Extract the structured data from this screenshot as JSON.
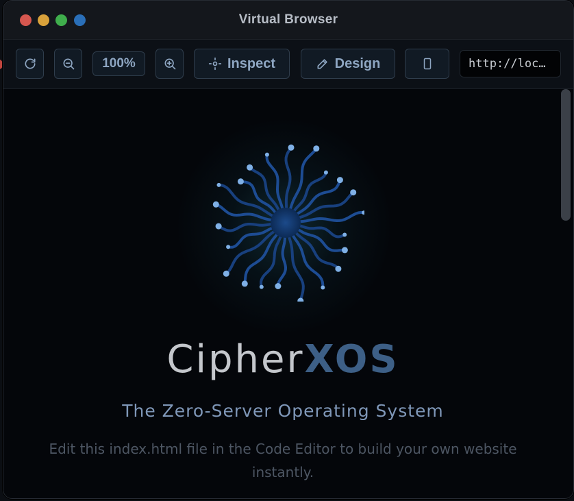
{
  "window": {
    "title": "Virtual Browser"
  },
  "toolbar": {
    "zoom_level": "100%",
    "inspect_label": "Inspect",
    "design_label": "Design",
    "url": "http://localhost"
  },
  "page": {
    "brand_part1": "Cipher",
    "brand_part2": "XOS",
    "tagline": "The Zero-Server Operating System",
    "description": "Edit this index.html file in the Code Editor to build your own website instantly."
  },
  "colors": {
    "accent": "#3d5f86",
    "tagline": "#7f97b8",
    "background": "#04060a"
  },
  "icons": [
    "refresh-icon",
    "zoom-out-icon",
    "zoom-in-icon",
    "inspect-icon",
    "pencil-icon",
    "mobile-device-icon"
  ]
}
